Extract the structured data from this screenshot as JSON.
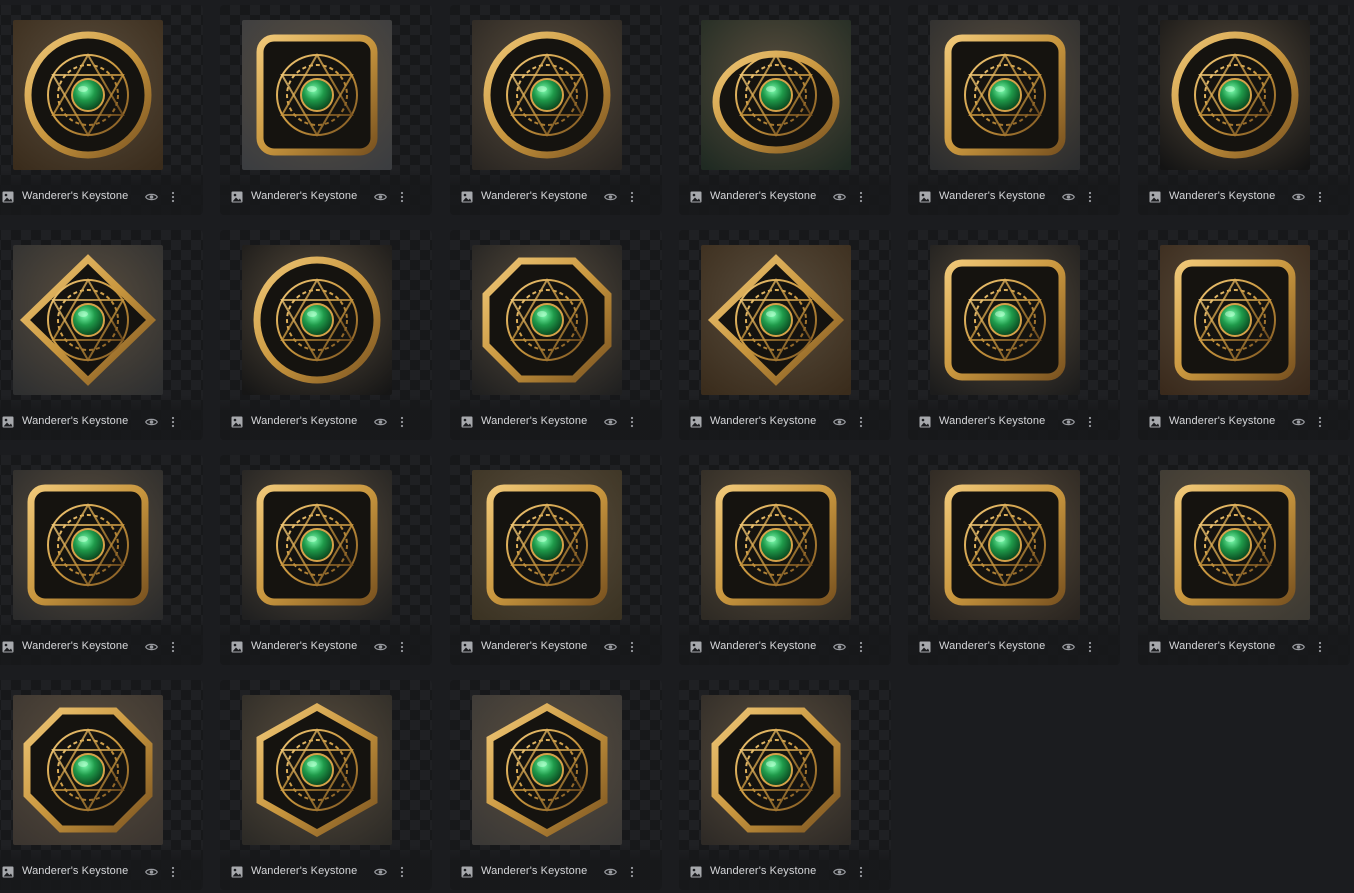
{
  "gallery": {
    "items": [
      {
        "title": "Wanderer's Keystone",
        "shape": "round",
        "bg": "#3a2c1c"
      },
      {
        "title": "Wanderer's Keystone",
        "shape": "square",
        "bg": "#3b3d40"
      },
      {
        "title": "Wanderer's Keystone",
        "shape": "round",
        "bg": "#2a2622"
      },
      {
        "title": "Wanderer's Keystone",
        "shape": "disc",
        "bg": "#1f2a22"
      },
      {
        "title": "Wanderer's Keystone",
        "shape": "square",
        "bg": "#2c2d2e"
      },
      {
        "title": "Wanderer's Keystone",
        "shape": "round",
        "bg": "#141414"
      },
      {
        "title": "Wanderer's Keystone",
        "shape": "diamond",
        "bg": "#2e2f30"
      },
      {
        "title": "Wanderer's Keystone",
        "shape": "round",
        "bg": "#161616"
      },
      {
        "title": "Wanderer's Keystone",
        "shape": "octagon",
        "bg": "#202020"
      },
      {
        "title": "Wanderer's Keystone",
        "shape": "diamond",
        "bg": "#3a2c1c"
      },
      {
        "title": "Wanderer's Keystone",
        "shape": "square",
        "bg": "#1c1c1c"
      },
      {
        "title": "Wanderer's Keystone",
        "shape": "square",
        "bg": "#3a2a1c"
      },
      {
        "title": "Wanderer's Keystone",
        "shape": "square",
        "bg": "#2b2b2b"
      },
      {
        "title": "Wanderer's Keystone",
        "shape": "square",
        "bg": "#202020"
      },
      {
        "title": "Wanderer's Keystone",
        "shape": "square",
        "bg": "#3b3323"
      },
      {
        "title": "Wanderer's Keystone",
        "shape": "square",
        "bg": "#2e2a24"
      },
      {
        "title": "Wanderer's Keystone",
        "shape": "square",
        "bg": "#2a2520"
      },
      {
        "title": "Wanderer's Keystone",
        "shape": "square",
        "bg": "#3d3a33"
      },
      {
        "title": "Wanderer's Keystone",
        "shape": "octagon",
        "bg": "#3b3530"
      },
      {
        "title": "Wanderer's Keystone",
        "shape": "hexagon",
        "bg": "#2c2a26"
      },
      {
        "title": "Wanderer's Keystone",
        "shape": "hexagon",
        "bg": "#3a3836"
      },
      {
        "title": "Wanderer's Keystone",
        "shape": "octagon",
        "bg": "#2e2a26"
      }
    ]
  },
  "colors": {
    "gold": "#c8963e",
    "gold_dark": "#7a5320",
    "gem": "#1f9a4a",
    "text": "#d6d7da",
    "icon": "#9a9ca1"
  },
  "icons": {
    "type": "image-icon",
    "view": "eye-icon",
    "menu": "more-vertical-icon"
  }
}
